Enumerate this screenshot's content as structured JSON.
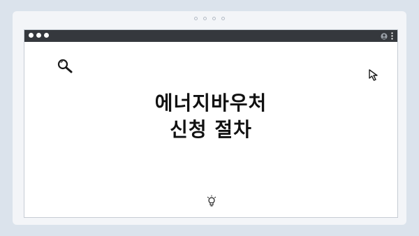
{
  "headline": {
    "line1": "에너지바우처",
    "line2": "신청 절차"
  },
  "icons": {
    "search": "magnifier-icon",
    "cursor": "cursor-icon",
    "bulb": "bulb-icon",
    "user": "avatar-icon",
    "menu": "kebab-icon"
  },
  "colors": {
    "background": "#dbe3ec",
    "titlebar": "#35383d",
    "text": "#111111"
  }
}
